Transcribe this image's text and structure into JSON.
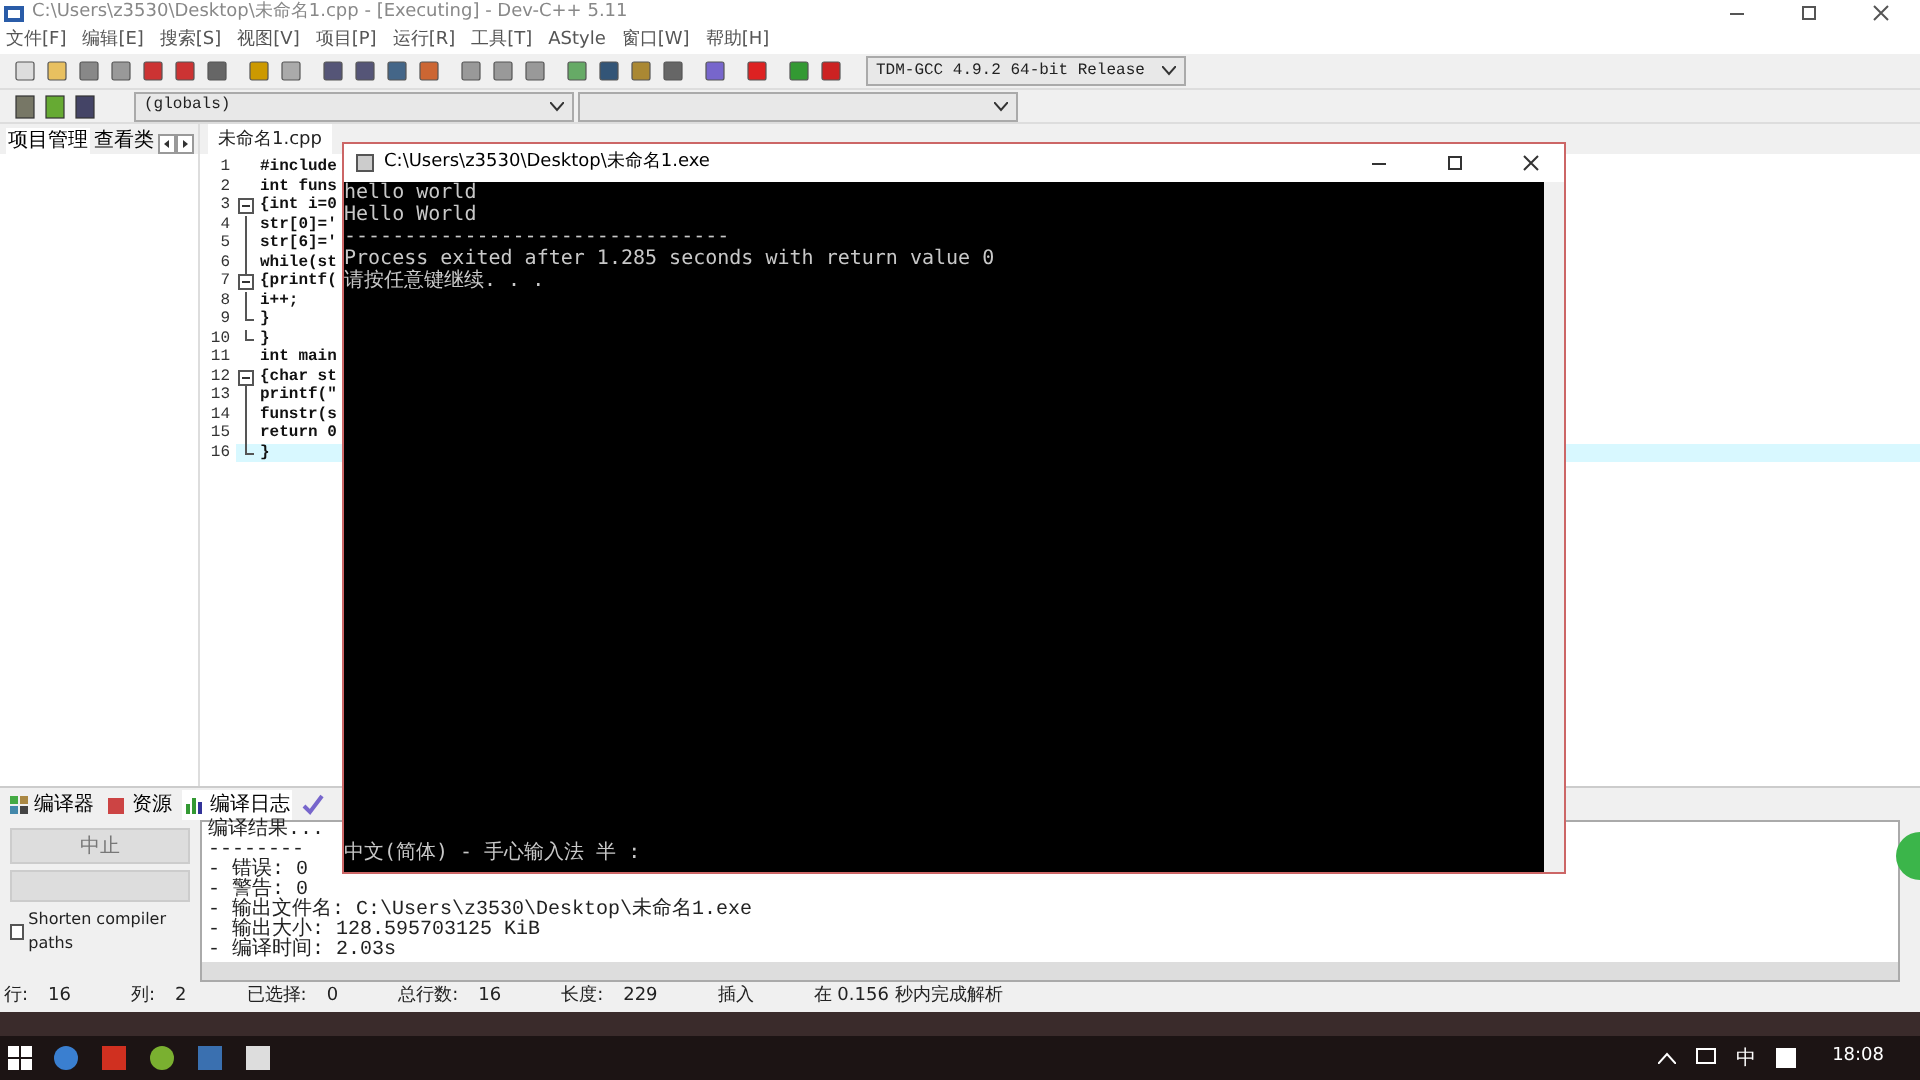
{
  "window": {
    "title": "C:\\Users\\z3530\\Desktop\\未命名1.cpp - [Executing] - Dev-C++ 5.11"
  },
  "menu": [
    "文件[F]",
    "编辑[E]",
    "搜索[S]",
    "视图[V]",
    "项目[P]",
    "运行[R]",
    "工具[T]",
    "AStyle",
    "窗口[W]",
    "帮助[H]"
  ],
  "toolbar": {
    "compiler": "TDM-GCC 4.9.2 64-bit Release",
    "scope": "(globals)"
  },
  "left_panel": {
    "tabs": [
      {
        "label": "项目管理",
        "selected": true
      },
      {
        "label": "查看类",
        "selected": false
      }
    ]
  },
  "editor": {
    "tab": "未命名1.cpp",
    "lines": [
      {
        "number": "1",
        "code": "#include",
        "kind": "plain",
        "current": false
      },
      {
        "number": "2",
        "code": "int funs",
        "kind": "plain",
        "current": false
      },
      {
        "number": "3",
        "code": "{int i=0",
        "kind": "fold-start",
        "current": false
      },
      {
        "number": "4",
        "code": "str[0]='",
        "kind": "fold-line",
        "current": false
      },
      {
        "number": "5",
        "code": "str[6]='",
        "kind": "fold-line",
        "current": false
      },
      {
        "number": "6",
        "code": "while(st",
        "kind": "fold-line",
        "current": false
      },
      {
        "number": "7",
        "code": "{printf(",
        "kind": "fold-start",
        "current": false
      },
      {
        "number": "8",
        "code": "i++;",
        "kind": "fold-line",
        "current": false
      },
      {
        "number": "9",
        "code": "}",
        "kind": "fold-end",
        "current": false
      },
      {
        "number": "10",
        "code": "}",
        "kind": "fold-end",
        "current": false
      },
      {
        "number": "11",
        "code": "int main",
        "kind": "plain",
        "current": false
      },
      {
        "number": "12",
        "code": "{char st",
        "kind": "fold-start",
        "current": false
      },
      {
        "number": "13",
        "code": "printf(\"",
        "kind": "fold-line",
        "current": false
      },
      {
        "number": "14",
        "code": "funstr(s",
        "kind": "fold-line",
        "current": false
      },
      {
        "number": "15",
        "code": "return 0",
        "kind": "fold-line",
        "current": false
      },
      {
        "number": "16",
        "code": "}",
        "kind": "fold-end",
        "current": true
      }
    ]
  },
  "bottom_panel": {
    "tabs": [
      {
        "label": "编译器",
        "selected": false
      },
      {
        "label": "资源",
        "selected": false
      },
      {
        "label": "编译日志",
        "selected": true
      },
      {
        "selected": false
      }
    ],
    "abort_button": {
      "label": "中止",
      "disabled": true
    },
    "shorten_paths": {
      "label": "Shorten compiler paths",
      "checked": false
    },
    "log": [
      "编译结果...",
      "--------",
      "- 错误: 0",
      "- 警告: 0",
      "- 输出文件名: C:\\Users\\z3530\\Desktop\\未命名1.exe",
      "- 输出大小: 128.595703125 KiB",
      "- 编译时间: 2.03s"
    ]
  },
  "status_bar": [
    {
      "label": "行:",
      "value": "16"
    },
    {
      "label": "列:",
      "value": "2"
    },
    {
      "label": "已选择:",
      "value": "0"
    },
    {
      "label": "总行数:",
      "value": "16"
    },
    {
      "label": "长度:",
      "value": "229"
    },
    {
      "value": "插入"
    },
    {
      "value": "在 0.156 秒内完成解析"
    }
  ],
  "console": {
    "title": "C:\\Users\\z3530\\Desktop\\未命名1.exe",
    "lines": [
      "hello world",
      "Hello World",
      "--------------------------------",
      "Process exited after 1.285 seconds with return value 0",
      "请按任意键继续. . ."
    ],
    "ime": "中文(简体) - 手心输入法 半 :"
  },
  "taskbar": {
    "ime": "中",
    "clock": "18:08"
  }
}
